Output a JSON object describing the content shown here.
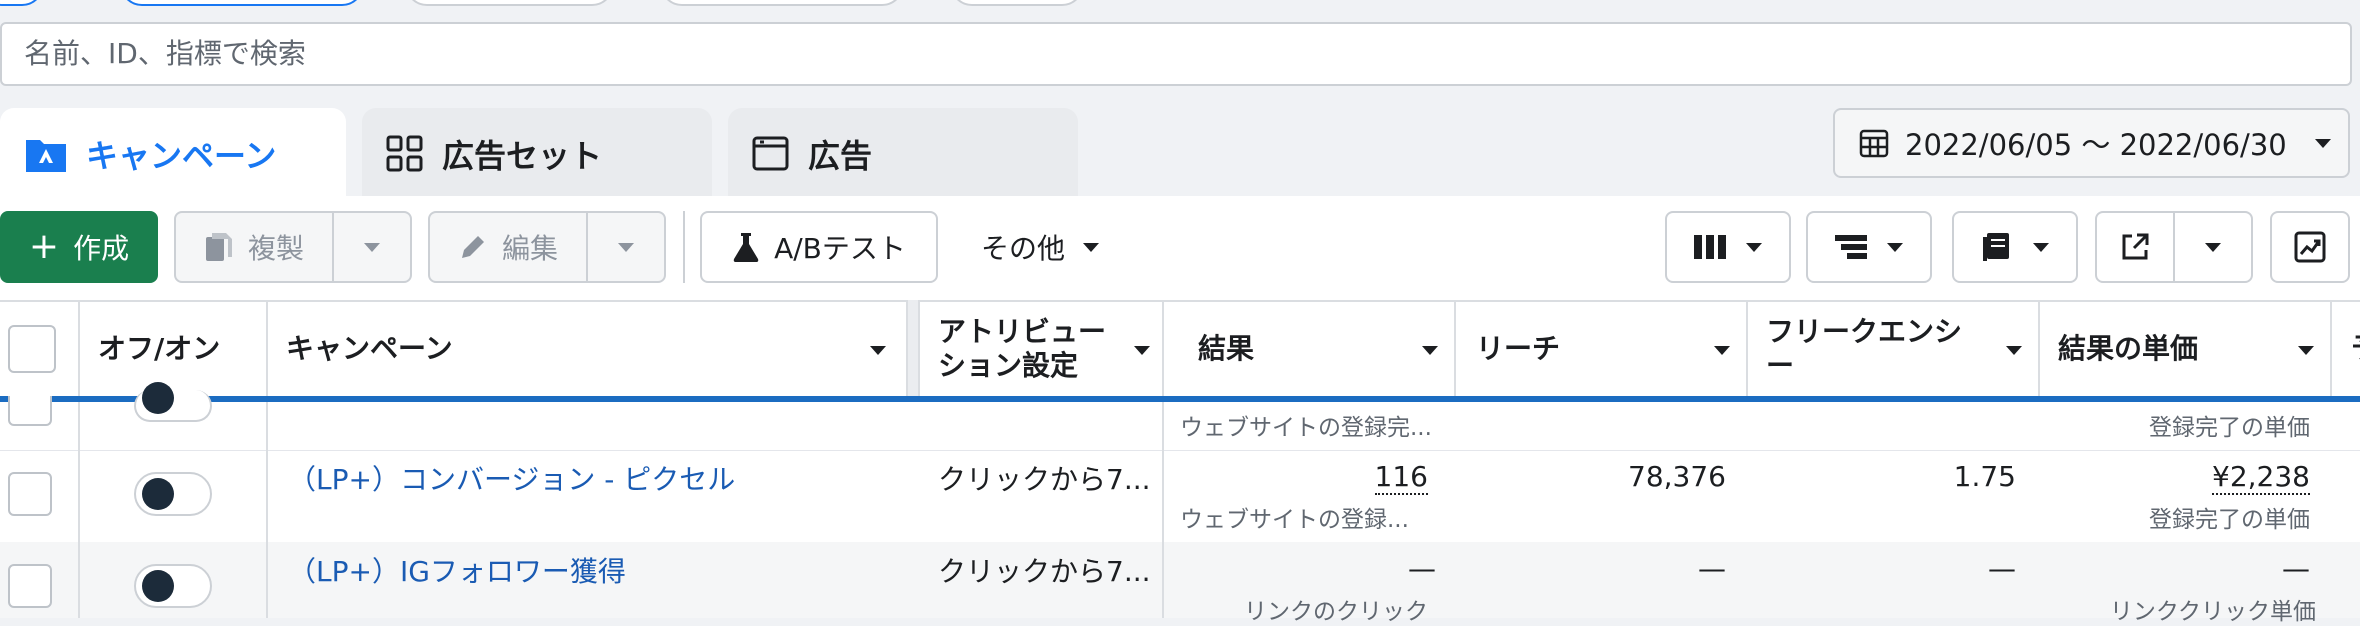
{
  "search": {
    "placeholder": "名前、ID、指標で検索"
  },
  "tabs": [
    {
      "label": "キャンペーン",
      "icon": "campaign-folder-icon",
      "active": true
    },
    {
      "label": "広告セット",
      "icon": "grid-icon",
      "active": false
    },
    {
      "label": "広告",
      "icon": "ad-window-icon",
      "active": false
    }
  ],
  "date_range": {
    "label": "2022/06/05 〜 2022/06/30",
    "icon": "calendar-icon"
  },
  "toolbar": {
    "create_label": "作成",
    "duplicate_label": "複製",
    "edit_label": "編集",
    "ab_test_label": "A/Bテスト",
    "more_label": "その他"
  },
  "table": {
    "headers": {
      "onoff": "オフ/オン",
      "campaign": "キャンペーン",
      "attribution": "アトリビューション設定",
      "results": "結果",
      "reach": "リーチ",
      "frequency": "フリークエンシー",
      "cost_per_result": "結果の単価",
      "next": "予"
    },
    "partial_row": {
      "results_sub": "ウェブサイトの登録完...",
      "cost_sub": "登録完了の単価"
    },
    "rows": [
      {
        "name": "（LP+）コンバージョン - ピクセル",
        "attribution": "クリックから7...",
        "results": "116",
        "results_sub": "ウェブサイトの登録...",
        "reach": "78,376",
        "frequency": "1.75",
        "cost": "¥2,238",
        "cost_sub": "登録完了の単価"
      },
      {
        "name": "（LP+）IGフォロワー獲得",
        "attribution": "クリックから7...",
        "results": "—",
        "results_sub": "リンクのクリック",
        "reach": "—",
        "frequency": "—",
        "cost": "—",
        "cost_sub": "リンククリック単価"
      }
    ]
  },
  "colors": {
    "accent": "#1877f2",
    "create": "#1a7f4e",
    "link": "#1a5bb3",
    "selection_line": "#1b6cc1"
  }
}
